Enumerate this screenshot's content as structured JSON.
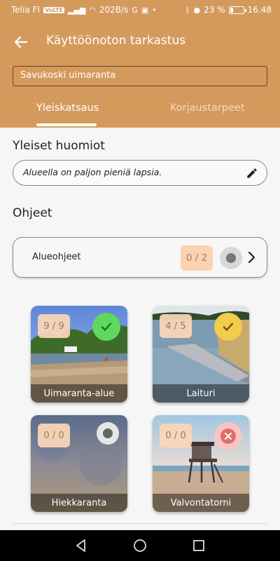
{
  "status_bar": {
    "carrier": "Telia FI",
    "volte": "VoLTE",
    "speed": "202B/s",
    "battery": "23 %",
    "battery_level": 0.23,
    "time": "16.48"
  },
  "toolbar": {
    "title": "Käyttöönoton tarkastus"
  },
  "site": {
    "value": "Savukoski uimaranta"
  },
  "tabs": [
    {
      "label": "Yleiskatsaus",
      "active": true
    },
    {
      "label": "Korjaustarpeet",
      "active": false
    }
  ],
  "general": {
    "heading": "Yleiset huomiot",
    "note": "Alueella on paljon pieniä lapsia."
  },
  "instructions": {
    "heading": "Ohjeet",
    "area": {
      "label": "Alueohjeet",
      "count": "0 / 2",
      "status": "unchecked"
    }
  },
  "areas": [
    {
      "label": "Uimaranta-alue",
      "count": "9 / 9",
      "status": "complete",
      "status_color": "#5ed95e"
    },
    {
      "label": "Laituri",
      "count": "4 / 5",
      "status": "partial",
      "status_color": "#f2cc4a"
    },
    {
      "label": "Hiekkaranta",
      "count": "0 / 0",
      "status": "none",
      "status_color": "#e6e6e6"
    },
    {
      "label": "Valvontatorni",
      "count": "0 / 0",
      "status": "failed",
      "status_color": "#f7c6c4"
    }
  ],
  "colors": {
    "accent": "#d49a5c",
    "count_badge": "#fbd3b0"
  },
  "icons": {
    "back": "arrow-left-icon",
    "edit": "pencil-icon",
    "chevron": "chevron-right-icon"
  }
}
